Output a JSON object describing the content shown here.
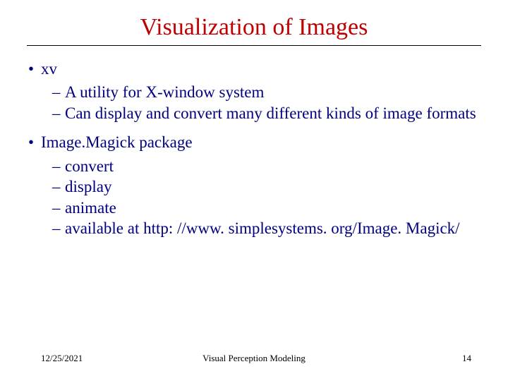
{
  "title": "Visualization of Images",
  "items": [
    {
      "label": "xv",
      "subs": [
        "A utility for X-window system",
        "Can display and convert many different kinds of image formats"
      ]
    },
    {
      "label": "Image.Magick package",
      "subs": [
        "convert",
        "display",
        "animate",
        "available at http: //www. simplesystems. org/Image. Magick/"
      ]
    }
  ],
  "footer": {
    "date": "12/25/2021",
    "center": "Visual Perception Modeling",
    "page": "14"
  }
}
